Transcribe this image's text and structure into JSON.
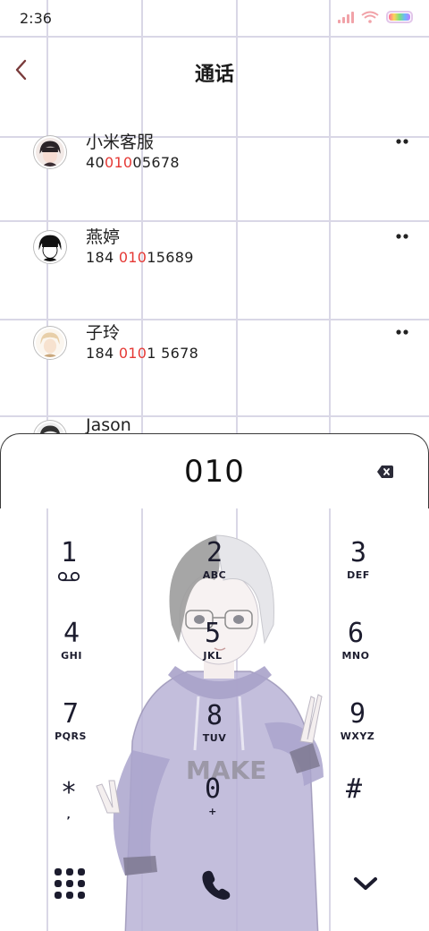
{
  "status_bar": {
    "time": "2:36"
  },
  "header": {
    "title": "通话"
  },
  "contacts": [
    {
      "name": "小米客服",
      "number_parts": [
        "40",
        "010",
        "05678"
      ]
    },
    {
      "name": "燕婷",
      "number_parts": [
        "184 ",
        "010",
        "15689"
      ]
    },
    {
      "name": "子玲",
      "number_parts": [
        "184 ",
        "010",
        "1 5678"
      ]
    },
    {
      "name": "Jason"
    }
  ],
  "dialer": {
    "number": "010",
    "keys": [
      {
        "digit": "1",
        "letters": ""
      },
      {
        "digit": "2",
        "letters": "ABC"
      },
      {
        "digit": "3",
        "letters": "DEF"
      },
      {
        "digit": "4",
        "letters": "GHI"
      },
      {
        "digit": "5",
        "letters": "JKL"
      },
      {
        "digit": "6",
        "letters": "MNO"
      },
      {
        "digit": "7",
        "letters": "PQRS"
      },
      {
        "digit": "8",
        "letters": "TUV"
      },
      {
        "digit": "9",
        "letters": "WXYZ"
      },
      {
        "digit": "*",
        "letters": ","
      },
      {
        "digit": "0",
        "letters": "+"
      },
      {
        "digit": "#",
        "letters": ""
      }
    ],
    "character_text": "MAKE"
  },
  "colors": {
    "highlight": "#e53935",
    "back_arrow": "#7a3b3b",
    "grid": "#d9d7e6"
  }
}
